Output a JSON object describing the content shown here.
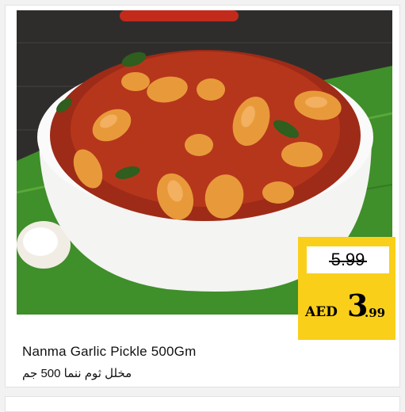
{
  "product": {
    "image_alt_icon": "garlic-pickle-bowl-image",
    "title_en": "Nanma Garlic Pickle 500Gm",
    "title_ar": "مخلل ثوم ننما 500 جم"
  },
  "price": {
    "old": "5.99",
    "currency": "AED",
    "integer": "3",
    "decimal": ".99"
  },
  "colors": {
    "tag_yellow": "#f9cf1a",
    "leaf_green": "#3f8f2a",
    "pickle_red": "#b6361c",
    "garlic": "#e89a3a"
  }
}
